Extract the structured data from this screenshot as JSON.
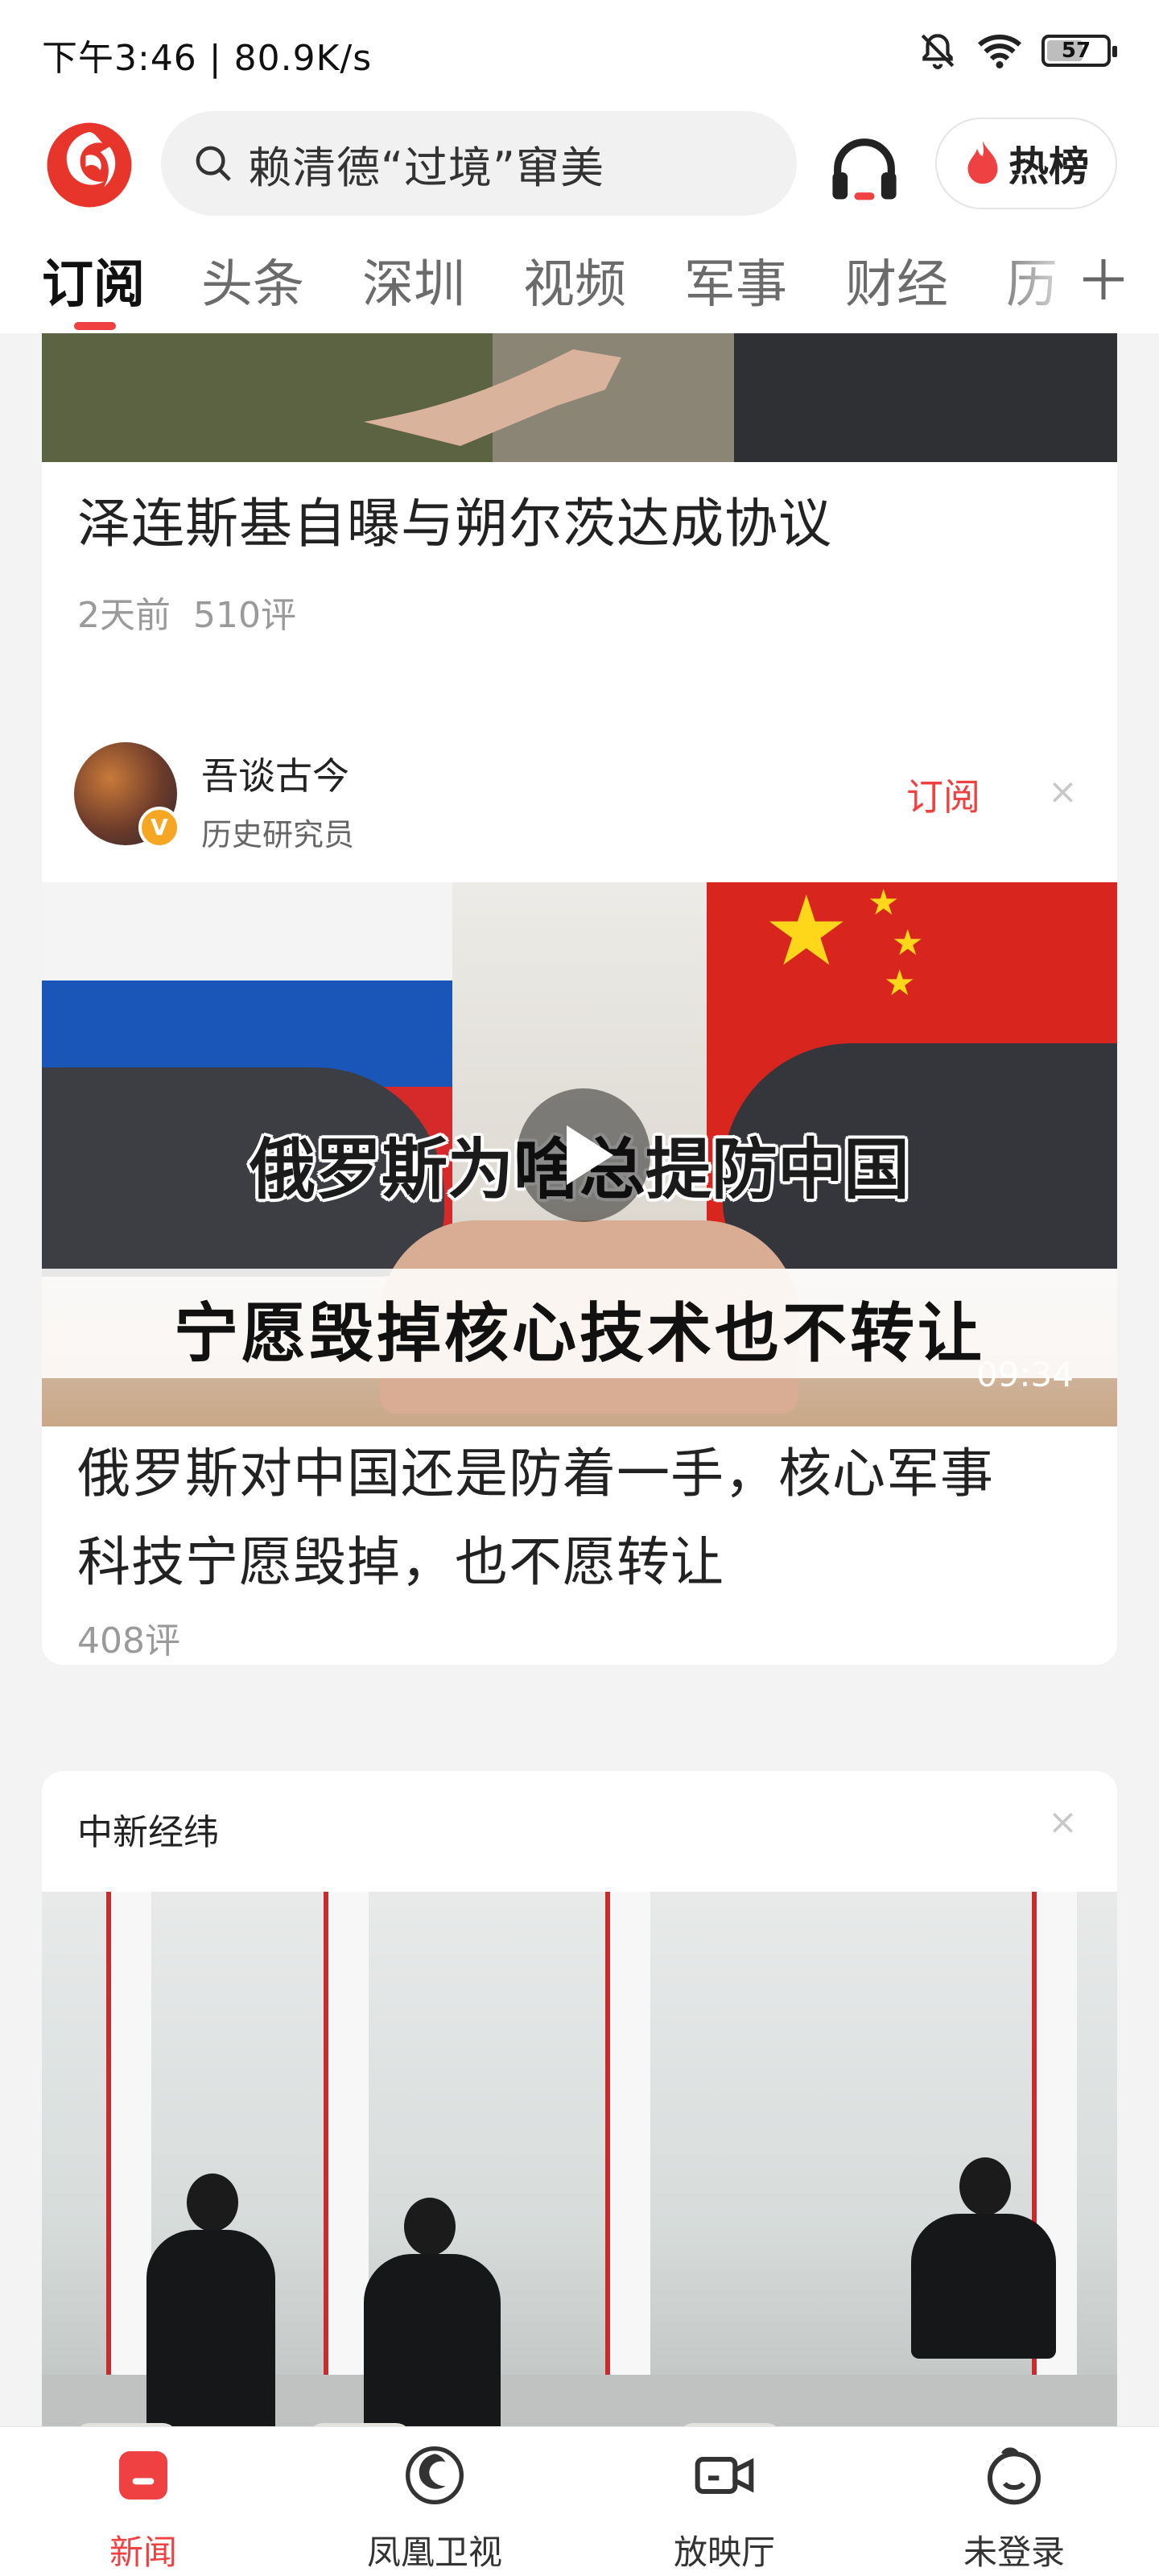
{
  "status_bar": {
    "left_text": "下午3:46 | 80.9K/s",
    "battery": "57"
  },
  "header": {
    "search_placeholder": "赖清德“过境”窜美",
    "hot_label": "热榜"
  },
  "tabs": [
    "订阅",
    "头条",
    "深圳",
    "视频",
    "军事",
    "财经",
    "历"
  ],
  "feed": {
    "card1": {
      "title": "泽连斯基自曝与朔尔茨达成协议",
      "time": "2天前",
      "comments": "510评"
    },
    "card2": {
      "author_name": "吾谈古今",
      "author_desc": "历史研究员",
      "subscribe_label": "订阅",
      "video_caption_1": "俄罗斯为啥总提防中国",
      "video_caption_2": "宁愿毁掉核心技术也不转让",
      "duration": "09:34",
      "title_line1": "俄罗斯对中国还是防着一手，核心军事",
      "title_line2": "科技宁愿毁掉，也不愿转让",
      "comments": "408评"
    },
    "card3": {
      "source": "中新经纬"
    }
  },
  "bottom_nav": [
    {
      "label": "新闻",
      "icon": "news-icon"
    },
    {
      "label": "凤凰卫视",
      "icon": "phoenix-tv-icon"
    },
    {
      "label": "放映厅",
      "icon": "video-camera-icon"
    },
    {
      "label": "未登录",
      "icon": "user-icon"
    }
  ],
  "colors": {
    "accent": "#f04142",
    "background": "#f3f3f3"
  }
}
